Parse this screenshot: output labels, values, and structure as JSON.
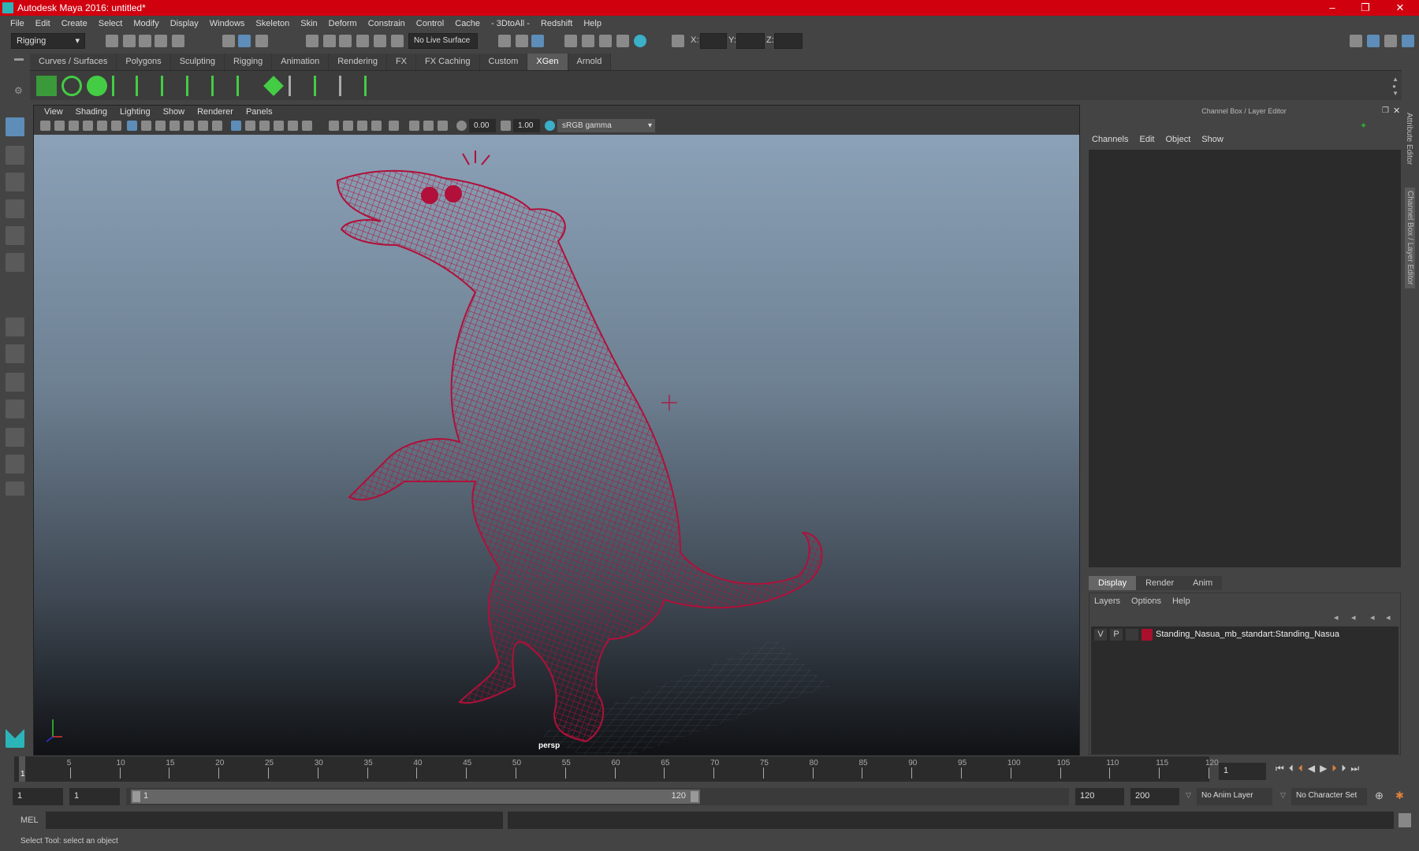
{
  "window": {
    "title": "Autodesk Maya 2016: untitled*",
    "controls": [
      "–",
      "❐",
      "✕"
    ]
  },
  "menubar": [
    "File",
    "Edit",
    "Create",
    "Select",
    "Modify",
    "Display",
    "Windows",
    "Skeleton",
    "Skin",
    "Deform",
    "Constrain",
    "Control",
    "Cache",
    "- 3DtoAll -",
    "Redshift",
    "Help"
  ],
  "toolbar": {
    "mode": "Rigging",
    "live_surface": "No Live Surface",
    "x_label": "X:",
    "y_label": "Y:",
    "z_label": "Z:"
  },
  "shelf": {
    "tabs": [
      "Curves / Surfaces",
      "Polygons",
      "Sculpting",
      "Rigging",
      "Animation",
      "Rendering",
      "FX",
      "FX Caching",
      "Custom",
      "XGen",
      "Arnold"
    ],
    "active": "XGen"
  },
  "viewport": {
    "menu": [
      "View",
      "Shading",
      "Lighting",
      "Show",
      "Renderer",
      "Panels"
    ],
    "exposure": "0.00",
    "gamma": "1.00",
    "colorspace": "sRGB gamma",
    "camera": "persp",
    "wire_color": "#b0103a"
  },
  "channelbox": {
    "title": "Channel Box / Layer Editor",
    "menu": [
      "Channels",
      "Edit",
      "Object",
      "Show"
    ]
  },
  "layereditor": {
    "tabs": [
      "Display",
      "Render",
      "Anim"
    ],
    "active": "Display",
    "menu": [
      "Layers",
      "Options",
      "Help"
    ],
    "layers": [
      {
        "v": "V",
        "p": "P",
        "color": "#a8102e",
        "name": "Standing_Nasua_mb_standart:Standing_Nasua"
      }
    ]
  },
  "sidetabs": [
    "Attribute Editor",
    "Channel Box / Layer Editor"
  ],
  "timeline": {
    "ticks": [
      "5",
      "10",
      "15",
      "20",
      "25",
      "30",
      "35",
      "40",
      "45",
      "50",
      "55",
      "60",
      "65",
      "70",
      "75",
      "80",
      "85",
      "90",
      "95",
      "100",
      "105",
      "110",
      "115",
      "120"
    ],
    "current": "1",
    "current_field": "1"
  },
  "range": {
    "start": "1",
    "start2": "1",
    "slider_start": "1",
    "slider_end": "120",
    "end": "120",
    "end2": "200",
    "anim_layer": "No Anim Layer",
    "char_set": "No Character Set"
  },
  "cmdline": {
    "lang": "MEL"
  },
  "status": "Select Tool: select an object"
}
